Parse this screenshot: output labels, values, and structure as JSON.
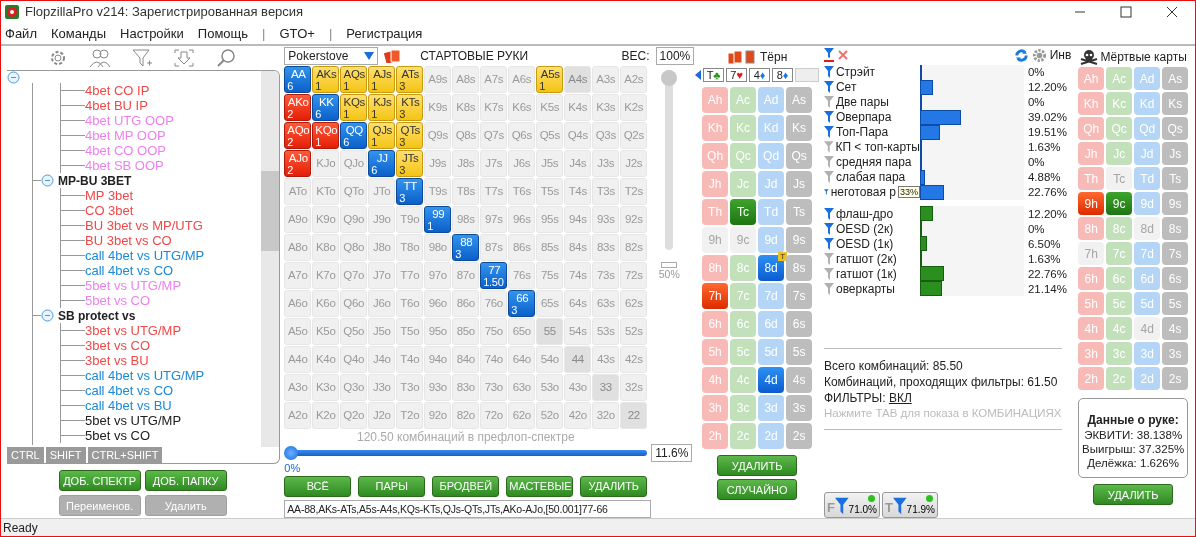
{
  "window": {
    "title": "FlopzillaPro v214: Зарегистрированная версия"
  },
  "menu": [
    {
      "label": "Файл",
      "kind": "item"
    },
    {
      "label": "Команды",
      "kind": "item"
    },
    {
      "label": "Настройки",
      "kind": "item"
    },
    {
      "label": "Помощь",
      "kind": "item"
    },
    {
      "label": "|",
      "kind": "separator"
    },
    {
      "label": "GTO+",
      "kind": "item"
    },
    {
      "label": "|",
      "kind": "separator"
    },
    {
      "label": "Регистрация",
      "kind": "item"
    }
  ],
  "tree": {
    "expanded": true,
    "groups": [
      {
        "items": [
          {
            "label": "4bet CO IP",
            "color": "#f04848"
          },
          {
            "label": "4bet BU IP",
            "color": "#f04848"
          },
          {
            "label": "4bet UTG OOP",
            "color": "#f080f0"
          },
          {
            "label": "4bet MP OOP",
            "color": "#f080f0"
          },
          {
            "label": "4bet CO OOP",
            "color": "#f080f0"
          },
          {
            "label": "4bet SB OOP",
            "color": "#f080f0"
          }
        ]
      },
      {
        "label": "MP-BU 3BET",
        "expanded": true,
        "items": [
          {
            "label": "MP 3bet",
            "color": "#f04848"
          },
          {
            "label": "CO 3bet",
            "color": "#f04848"
          },
          {
            "label": "BU 3bet vs MP/UTG",
            "color": "#f04848"
          },
          {
            "label": "BU 3bet vs CO",
            "color": "#f04848"
          },
          {
            "label": "call 4bet vs UTG/MP",
            "color": "#1a8ad8"
          },
          {
            "label": "call 4bet vs CO",
            "color": "#1a8ad8"
          },
          {
            "label": "5bet vs UTG/MP",
            "color": "#f080f0"
          },
          {
            "label": "5bet vs CO",
            "color": "#f080f0"
          }
        ]
      },
      {
        "label": "SB protect vs",
        "expanded": true,
        "items": [
          {
            "label": "3bet vs UTG/MP",
            "color": "#f04848"
          },
          {
            "label": "3bet vs CO",
            "color": "#f04848"
          },
          {
            "label": "3bet vs BU",
            "color": "#f04848"
          },
          {
            "label": "call 4bet vs UTG/MP",
            "color": "#1a8ad8"
          },
          {
            "label": "call 4bet vs CO",
            "color": "#1a8ad8"
          },
          {
            "label": "call 4bet vs BU",
            "color": "#1a8ad8"
          },
          {
            "label": "5bet vs UTG/MP",
            "color": "#202020"
          },
          {
            "label": "5bet vs CO",
            "color": "#202020"
          }
        ]
      }
    ]
  },
  "keys": [
    "CTRL",
    "SHIFT",
    "CTRL+SHIFT"
  ],
  "left_buttons": [
    {
      "label": "ДОБ. СПЕКТР",
      "disabled": false
    },
    {
      "label": "ДОБ. ПАПКУ",
      "disabled": false
    },
    {
      "label": "Переименов.",
      "disabled": true
    },
    {
      "label": "Удалить",
      "disabled": true
    }
  ],
  "range": {
    "preset": "Pokerstove",
    "title": "СТАРТОВЫЕ РУКИ",
    "weight_label": "ВЕС:",
    "weight": "100%",
    "weight_slider": {
      "level": 1,
      "mark_label": "50%"
    },
    "rows": [
      [
        {
          "label": "AA",
          "kind": "pair",
          "count": "6"
        },
        {
          "label": "AKs",
          "kind": "suited",
          "count": "1"
        },
        {
          "label": "AQs",
          "kind": "suited",
          "count": "1"
        },
        {
          "label": "AJs",
          "kind": "suited",
          "count": "1"
        },
        {
          "label": "ATs",
          "kind": "suited",
          "count": "3"
        },
        {
          "label": "A9s",
          "kind": "none"
        },
        {
          "label": "A8s",
          "kind": "none"
        },
        {
          "label": "A7s",
          "kind": "none"
        },
        {
          "label": "A6s",
          "kind": "none"
        },
        {
          "label": "A5s",
          "kind": "suited",
          "count": "1"
        },
        {
          "label": "A4s",
          "kind": "dim"
        },
        {
          "label": "A3s",
          "kind": "none"
        },
        {
          "label": "A2s",
          "kind": "none"
        }
      ],
      [
        {
          "label": "AKo",
          "kind": "offsuit",
          "count": "2"
        },
        {
          "label": "KK",
          "kind": "pair",
          "count": "6"
        },
        {
          "label": "KQs",
          "kind": "suited",
          "count": "1"
        },
        {
          "label": "KJs",
          "kind": "suited",
          "count": "1"
        },
        {
          "label": "KTs",
          "kind": "suited",
          "count": "3"
        },
        {
          "label": "K9s",
          "kind": "none"
        },
        {
          "label": "K8s",
          "kind": "none"
        },
        {
          "label": "K7s",
          "kind": "none"
        },
        {
          "label": "K6s",
          "kind": "none"
        },
        {
          "label": "K5s",
          "kind": "none"
        },
        {
          "label": "K4s",
          "kind": "none"
        },
        {
          "label": "K3s",
          "kind": "none"
        },
        {
          "label": "K2s",
          "kind": "none"
        }
      ],
      [
        {
          "label": "AQo",
          "kind": "offsuit",
          "count": "2"
        },
        {
          "label": "KQo",
          "kind": "offsuit",
          "count": "1"
        },
        {
          "label": "QQ",
          "kind": "pair",
          "count": "6"
        },
        {
          "label": "QJs",
          "kind": "suited",
          "count": "1"
        },
        {
          "label": "QTs",
          "kind": "suited",
          "count": "3"
        },
        {
          "label": "Q9s",
          "kind": "none"
        },
        {
          "label": "Q8s",
          "kind": "none"
        },
        {
          "label": "Q7s",
          "kind": "none"
        },
        {
          "label": "Q6s",
          "kind": "none"
        },
        {
          "label": "Q5s",
          "kind": "none"
        },
        {
          "label": "Q4s",
          "kind": "none"
        },
        {
          "label": "Q3s",
          "kind": "none"
        },
        {
          "label": "Q2s",
          "kind": "none"
        }
      ],
      [
        {
          "label": "AJo",
          "kind": "offsuit",
          "count": "2"
        },
        {
          "label": "KJo",
          "kind": "none"
        },
        {
          "label": "QJo",
          "kind": "none"
        },
        {
          "label": "JJ",
          "kind": "pair",
          "count": "6"
        },
        {
          "label": "JTs",
          "kind": "suited",
          "count": "3"
        },
        {
          "label": "J9s",
          "kind": "none"
        },
        {
          "label": "J8s",
          "kind": "none"
        },
        {
          "label": "J7s",
          "kind": "none"
        },
        {
          "label": "J6s",
          "kind": "none"
        },
        {
          "label": "J5s",
          "kind": "none"
        },
        {
          "label": "J4s",
          "kind": "none"
        },
        {
          "label": "J3s",
          "kind": "none"
        },
        {
          "label": "J2s",
          "kind": "none"
        }
      ],
      [
        {
          "label": "ATo",
          "kind": "none"
        },
        {
          "label": "KTo",
          "kind": "none"
        },
        {
          "label": "QTo",
          "kind": "none"
        },
        {
          "label": "JTo",
          "kind": "none"
        },
        {
          "label": "TT",
          "kind": "pair",
          "count": "3"
        },
        {
          "label": "T9s",
          "kind": "none"
        },
        {
          "label": "T8s",
          "kind": "none"
        },
        {
          "label": "T7s",
          "kind": "none"
        },
        {
          "label": "T6s",
          "kind": "none"
        },
        {
          "label": "T5s",
          "kind": "none"
        },
        {
          "label": "T4s",
          "kind": "none"
        },
        {
          "label": "T3s",
          "kind": "none"
        },
        {
          "label": "T2s",
          "kind": "none"
        }
      ],
      [
        {
          "label": "A9o",
          "kind": "none"
        },
        {
          "label": "K9o",
          "kind": "none"
        },
        {
          "label": "Q9o",
          "kind": "none"
        },
        {
          "label": "J9o",
          "kind": "none"
        },
        {
          "label": "T9o",
          "kind": "none"
        },
        {
          "label": "99",
          "kind": "pair",
          "count": "1"
        },
        {
          "label": "98s",
          "kind": "none"
        },
        {
          "label": "97s",
          "kind": "none"
        },
        {
          "label": "96s",
          "kind": "none"
        },
        {
          "label": "95s",
          "kind": "none"
        },
        {
          "label": "94s",
          "kind": "none"
        },
        {
          "label": "93s",
          "kind": "none"
        },
        {
          "label": "92s",
          "kind": "none"
        }
      ],
      [
        {
          "label": "A8o",
          "kind": "none"
        },
        {
          "label": "K8o",
          "kind": "none"
        },
        {
          "label": "Q8o",
          "kind": "none"
        },
        {
          "label": "J8o",
          "kind": "none"
        },
        {
          "label": "T8o",
          "kind": "none"
        },
        {
          "label": "98o",
          "kind": "none"
        },
        {
          "label": "88",
          "kind": "pair",
          "count": "3"
        },
        {
          "label": "87s",
          "kind": "none"
        },
        {
          "label": "86s",
          "kind": "none"
        },
        {
          "label": "85s",
          "kind": "none"
        },
        {
          "label": "84s",
          "kind": "none"
        },
        {
          "label": "83s",
          "kind": "none"
        },
        {
          "label": "82s",
          "kind": "none"
        }
      ],
      [
        {
          "label": "A7o",
          "kind": "none"
        },
        {
          "label": "K7o",
          "kind": "none"
        },
        {
          "label": "Q7o",
          "kind": "none"
        },
        {
          "label": "J7o",
          "kind": "none"
        },
        {
          "label": "T7o",
          "kind": "none"
        },
        {
          "label": "97o",
          "kind": "none"
        },
        {
          "label": "87o",
          "kind": "none"
        },
        {
          "label": "77",
          "kind": "pair",
          "count": "1.50"
        },
        {
          "label": "76s",
          "kind": "none"
        },
        {
          "label": "75s",
          "kind": "none"
        },
        {
          "label": "74s",
          "kind": "none"
        },
        {
          "label": "73s",
          "kind": "none"
        },
        {
          "label": "72s",
          "kind": "none"
        }
      ],
      [
        {
          "label": "A6o",
          "kind": "none"
        },
        {
          "label": "K6o",
          "kind": "none"
        },
        {
          "label": "Q6o",
          "kind": "none"
        },
        {
          "label": "J6o",
          "kind": "none"
        },
        {
          "label": "T6o",
          "kind": "none"
        },
        {
          "label": "96o",
          "kind": "none"
        },
        {
          "label": "86o",
          "kind": "none"
        },
        {
          "label": "76o",
          "kind": "none"
        },
        {
          "label": "66",
          "kind": "pair",
          "count": "3"
        },
        {
          "label": "65s",
          "kind": "none"
        },
        {
          "label": "64s",
          "kind": "none"
        },
        {
          "label": "63s",
          "kind": "none"
        },
        {
          "label": "62s",
          "kind": "none"
        }
      ],
      [
        {
          "label": "A5o",
          "kind": "none"
        },
        {
          "label": "K5o",
          "kind": "none"
        },
        {
          "label": "Q5o",
          "kind": "none"
        },
        {
          "label": "J5o",
          "kind": "none"
        },
        {
          "label": "T5o",
          "kind": "none"
        },
        {
          "label": "95o",
          "kind": "none"
        },
        {
          "label": "85o",
          "kind": "none"
        },
        {
          "label": "75o",
          "kind": "none"
        },
        {
          "label": "65o",
          "kind": "none"
        },
        {
          "label": "55",
          "kind": "dim"
        },
        {
          "label": "54s",
          "kind": "none"
        },
        {
          "label": "53s",
          "kind": "none"
        },
        {
          "label": "52s",
          "kind": "none"
        }
      ],
      [
        {
          "label": "A4o",
          "kind": "none"
        },
        {
          "label": "K4o",
          "kind": "none"
        },
        {
          "label": "Q4o",
          "kind": "none"
        },
        {
          "label": "J4o",
          "kind": "none"
        },
        {
          "label": "T4o",
          "kind": "none"
        },
        {
          "label": "94o",
          "kind": "none"
        },
        {
          "label": "84o",
          "kind": "none"
        },
        {
          "label": "74o",
          "kind": "none"
        },
        {
          "label": "64o",
          "kind": "none"
        },
        {
          "label": "54o",
          "kind": "none"
        },
        {
          "label": "44",
          "kind": "dim"
        },
        {
          "label": "43s",
          "kind": "none"
        },
        {
          "label": "42s",
          "kind": "none"
        }
      ],
      [
        {
          "label": "A3o",
          "kind": "none"
        },
        {
          "label": "K3o",
          "kind": "none"
        },
        {
          "label": "Q3o",
          "kind": "none"
        },
        {
          "label": "J3o",
          "kind": "none"
        },
        {
          "label": "T3o",
          "kind": "none"
        },
        {
          "label": "93o",
          "kind": "none"
        },
        {
          "label": "83o",
          "kind": "none"
        },
        {
          "label": "73o",
          "kind": "none"
        },
        {
          "label": "63o",
          "kind": "none"
        },
        {
          "label": "53o",
          "kind": "none"
        },
        {
          "label": "43o",
          "kind": "none"
        },
        {
          "label": "33",
          "kind": "dim"
        },
        {
          "label": "32s",
          "kind": "none"
        }
      ],
      [
        {
          "label": "A2o",
          "kind": "none"
        },
        {
          "label": "K2o",
          "kind": "none"
        },
        {
          "label": "Q2o",
          "kind": "none"
        },
        {
          "label": "J2o",
          "kind": "none"
        },
        {
          "label": "T2o",
          "kind": "none"
        },
        {
          "label": "92o",
          "kind": "none"
        },
        {
          "label": "82o",
          "kind": "none"
        },
        {
          "label": "72o",
          "kind": "none"
        },
        {
          "label": "62o",
          "kind": "none"
        },
        {
          "label": "52o",
          "kind": "none"
        },
        {
          "label": "42o",
          "kind": "none"
        },
        {
          "label": "32o",
          "kind": "none"
        },
        {
          "label": "22",
          "kind": "dim"
        }
      ]
    ],
    "combos_text": "120.50 комбинаций в префлоп-спектре",
    "percent_slider": {
      "level": 0,
      "min_label": "0%",
      "value": "11.6%"
    },
    "buttons": [
      "ВСЁ",
      "ПАРЫ",
      "БРОДВЕЙ",
      "МАСТЕВЫЕ",
      "УДАЛИТЬ"
    ],
    "range_text": "AA-88,AKs-ATs,A5s-A4s,KQs-KTs,QJs-QTs,JTs,AKo-AJo,[50.001]77-66"
  },
  "board": {
    "title": "Тёрн",
    "slots": [
      {
        "rank": "T",
        "suit": "♣",
        "kind": "clubs"
      },
      {
        "rank": "7",
        "suit": "♥",
        "kind": "hearts"
      },
      {
        "rank": "4",
        "suit": "♦",
        "kind": "diamonds"
      },
      {
        "rank": "8",
        "suit": "♦",
        "kind": "diamonds"
      },
      {
        "kind": "empty"
      }
    ],
    "deck": [
      [
        {
          "label": "Ah",
          "selected": false,
          "dead": false
        },
        {
          "label": "Ac",
          "selected": false,
          "dead": false
        },
        {
          "label": "Ad",
          "selected": false,
          "dead": false
        },
        {
          "label": "As",
          "selected": false,
          "dead": false
        }
      ],
      [
        {
          "label": "Kh",
          "selected": false,
          "dead": false
        },
        {
          "label": "Kc",
          "selected": false,
          "dead": false
        },
        {
          "label": "Kd",
          "selected": false,
          "dead": false
        },
        {
          "label": "Ks",
          "selected": false,
          "dead": false
        }
      ],
      [
        {
          "label": "Qh",
          "selected": false,
          "dead": false
        },
        {
          "label": "Qc",
          "selected": false,
          "dead": false
        },
        {
          "label": "Qd",
          "selected": false,
          "dead": false
        },
        {
          "label": "Qs",
          "selected": false,
          "dead": false
        }
      ],
      [
        {
          "label": "Jh",
          "selected": false,
          "dead": false
        },
        {
          "label": "Jc",
          "selected": false,
          "dead": false
        },
        {
          "label": "Jd",
          "selected": false,
          "dead": false
        },
        {
          "label": "Js",
          "selected": false,
          "dead": false
        }
      ],
      [
        {
          "label": "Th",
          "selected": false,
          "dead": false
        },
        {
          "label": "Tc",
          "selected": true,
          "dead": false
        },
        {
          "label": "Td",
          "selected": false,
          "dead": false
        },
        {
          "label": "Ts",
          "selected": false,
          "dead": false
        }
      ],
      [
        {
          "label": "9h",
          "selected": false,
          "dead": true
        },
        {
          "label": "9c",
          "selected": false,
          "dead": true
        },
        {
          "label": "9d",
          "selected": false,
          "dead": false
        },
        {
          "label": "9s",
          "selected": false,
          "dead": false
        }
      ],
      [
        {
          "label": "8h",
          "selected": false,
          "dead": false
        },
        {
          "label": "8c",
          "selected": false,
          "dead": false
        },
        {
          "label": "8d",
          "selected": true,
          "dead": false,
          "badge": "T"
        },
        {
          "label": "8s",
          "selected": false,
          "dead": false
        }
      ],
      [
        {
          "label": "7h",
          "selected": true,
          "dead": false
        },
        {
          "label": "7c",
          "selected": false,
          "dead": false
        },
        {
          "label": "7d",
          "selected": false,
          "dead": false
        },
        {
          "label": "7s",
          "selected": false,
          "dead": false
        }
      ],
      [
        {
          "label": "6h",
          "selected": false,
          "dead": false
        },
        {
          "label": "6c",
          "selected": false,
          "dead": false
        },
        {
          "label": "6d",
          "selected": false,
          "dead": false
        },
        {
          "label": "6s",
          "selected": false,
          "dead": false
        }
      ],
      [
        {
          "label": "5h",
          "selected": false,
          "dead": false
        },
        {
          "label": "5c",
          "selected": false,
          "dead": false
        },
        {
          "label": "5d",
          "selected": false,
          "dead": false
        },
        {
          "label": "5s",
          "selected": false,
          "dead": false
        }
      ],
      [
        {
          "label": "4h",
          "selected": false,
          "dead": false
        },
        {
          "label": "4c",
          "selected": false,
          "dead": false
        },
        {
          "label": "4d",
          "selected": true,
          "dead": false
        },
        {
          "label": "4s",
          "selected": false,
          "dead": false
        }
      ],
      [
        {
          "label": "3h",
          "selected": false,
          "dead": false
        },
        {
          "label": "3c",
          "selected": false,
          "dead": false
        },
        {
          "label": "3d",
          "selected": false,
          "dead": false
        },
        {
          "label": "3s",
          "selected": false,
          "dead": false
        }
      ],
      [
        {
          "label": "2h",
          "selected": false,
          "dead": false
        },
        {
          "label": "2c",
          "selected": false,
          "dead": false
        },
        {
          "label": "2d",
          "selected": false,
          "dead": false
        },
        {
          "label": "2s",
          "selected": false,
          "dead": false
        }
      ]
    ],
    "buttons": [
      "УДАЛИТЬ",
      "СЛУЧАЙНО"
    ]
  },
  "stats": {
    "invert_label": "Инв",
    "made": [
      {
        "label": "Стрэйт",
        "active": true,
        "value": "0%",
        "level": 0
      },
      {
        "label": "Сет",
        "active": true,
        "value": "12.20%",
        "level": 0.122
      },
      {
        "label": "Две пары",
        "active": false,
        "value": "0%",
        "level": 0
      },
      {
        "label": "Оверпара",
        "active": true,
        "value": "39.02%",
        "level": 0.3902
      },
      {
        "label": "Топ-Пара",
        "active": true,
        "value": "19.51%",
        "level": 0.1951
      },
      {
        "label": "КП < топ-карты",
        "active": false,
        "value": "1.63%",
        "level": 0.0163
      },
      {
        "label": "средняя пара",
        "active": false,
        "value": "0%",
        "level": 0
      },
      {
        "label": "слабая пара",
        "active": false,
        "value": "4.88%",
        "level": 0.0488
      },
      {
        "label": "неготовая р",
        "active": true,
        "value": "22.76%",
        "level": 0.2276,
        "tooltip": "33%"
      }
    ],
    "draws": [
      {
        "label": "флаш-дро",
        "active": true,
        "value": "12.20%",
        "level": 0.122
      },
      {
        "label": "OESD (2к)",
        "active": true,
        "value": "0%",
        "level": 0
      },
      {
        "label": "OESD (1к)",
        "active": true,
        "value": "6.50%",
        "level": 0.065
      },
      {
        "label": "гатшот (2к)",
        "active": false,
        "value": "1.63%",
        "level": 0.0163
      },
      {
        "label": "гатшот (1к)",
        "active": false,
        "value": "22.76%",
        "level": 0.2276
      },
      {
        "label": "оверкарты",
        "active": false,
        "value": "21.14%",
        "level": 0.2114
      }
    ],
    "totals": [
      "Всего комбинаций: 85.50",
      "Комбинаций, проходящих фильтры: 61.50"
    ],
    "filters_label": "ФИЛЬТРЫ:",
    "filters_link": "ВКЛ",
    "hint": "Нажмите ТАВ для показа в КОМБИНАЦИЯХ",
    "filter_buttons": [
      {
        "letter": "F",
        "value": "71.0%",
        "on": true
      },
      {
        "letter": "T",
        "value": "71.9%",
        "on": true
      }
    ]
  },
  "dead": {
    "title": "Мёртвые карты",
    "deck": [
      [
        {
          "label": "Ah",
          "selected": false,
          "dead": false
        },
        {
          "label": "Ac",
          "selected": false,
          "dead": false
        },
        {
          "label": "Ad",
          "selected": false,
          "dead": false
        },
        {
          "label": "As",
          "selected": false,
          "dead": false
        }
      ],
      [
        {
          "label": "Kh",
          "selected": false,
          "dead": false
        },
        {
          "label": "Kc",
          "selected": false,
          "dead": false
        },
        {
          "label": "Kd",
          "selected": false,
          "dead": false
        },
        {
          "label": "Ks",
          "selected": false,
          "dead": false
        }
      ],
      [
        {
          "label": "Qh",
          "selected": false,
          "dead": false
        },
        {
          "label": "Qc",
          "selected": false,
          "dead": false
        },
        {
          "label": "Qd",
          "selected": false,
          "dead": false
        },
        {
          "label": "Qs",
          "selected": false,
          "dead": false
        }
      ],
      [
        {
          "label": "Jh",
          "selected": false,
          "dead": false
        },
        {
          "label": "Jc",
          "selected": false,
          "dead": false
        },
        {
          "label": "Jd",
          "selected": false,
          "dead": false
        },
        {
          "label": "Js",
          "selected": false,
          "dead": false
        }
      ],
      [
        {
          "label": "Th",
          "selected": false,
          "dead": false
        },
        {
          "label": "Tc",
          "selected": false,
          "dead": true
        },
        {
          "label": "Td",
          "selected": false,
          "dead": false
        },
        {
          "label": "Ts",
          "selected": false,
          "dead": false
        }
      ],
      [
        {
          "label": "9h",
          "selected": true,
          "dead": false
        },
        {
          "label": "9c",
          "selected": true,
          "dead": false
        },
        {
          "label": "9d",
          "selected": false,
          "dead": false
        },
        {
          "label": "9s",
          "selected": false,
          "dead": false
        }
      ],
      [
        {
          "label": "8h",
          "selected": false,
          "dead": false
        },
        {
          "label": "8c",
          "selected": false,
          "dead": false
        },
        {
          "label": "8d",
          "selected": false,
          "dead": true
        },
        {
          "label": "8s",
          "selected": false,
          "dead": false
        }
      ],
      [
        {
          "label": "7h",
          "selected": false,
          "dead": true
        },
        {
          "label": "7c",
          "selected": false,
          "dead": false
        },
        {
          "label": "7d",
          "selected": false,
          "dead": false
        },
        {
          "label": "7s",
          "selected": false,
          "dead": false
        }
      ],
      [
        {
          "label": "6h",
          "selected": false,
          "dead": false
        },
        {
          "label": "6c",
          "selected": false,
          "dead": false
        },
        {
          "label": "6d",
          "selected": false,
          "dead": false
        },
        {
          "label": "6s",
          "selected": false,
          "dead": false
        }
      ],
      [
        {
          "label": "5h",
          "selected": false,
          "dead": false
        },
        {
          "label": "5c",
          "selected": false,
          "dead": false
        },
        {
          "label": "5d",
          "selected": false,
          "dead": false
        },
        {
          "label": "5s",
          "selected": false,
          "dead": false
        }
      ],
      [
        {
          "label": "4h",
          "selected": false,
          "dead": false
        },
        {
          "label": "4c",
          "selected": false,
          "dead": false
        },
        {
          "label": "4d",
          "selected": false,
          "dead": true
        },
        {
          "label": "4s",
          "selected": false,
          "dead": false
        }
      ],
      [
        {
          "label": "3h",
          "selected": false,
          "dead": false
        },
        {
          "label": "3c",
          "selected": false,
          "dead": false
        },
        {
          "label": "3d",
          "selected": false,
          "dead": false
        },
        {
          "label": "3s",
          "selected": false,
          "dead": false
        }
      ],
      [
        {
          "label": "2h",
          "selected": false,
          "dead": false
        },
        {
          "label": "2c",
          "selected": false,
          "dead": false
        },
        {
          "label": "2d",
          "selected": false,
          "dead": false
        },
        {
          "label": "2s",
          "selected": false,
          "dead": false
        }
      ]
    ],
    "hand_info": {
      "title": "Данные о руке:",
      "lines": [
        "ЭКВИТИ: 38.138%",
        "Выигрыш: 37.325%",
        "Делёжка: 1.626%"
      ]
    },
    "button": "УДАЛИТЬ"
  },
  "status_bar": "Ready"
}
